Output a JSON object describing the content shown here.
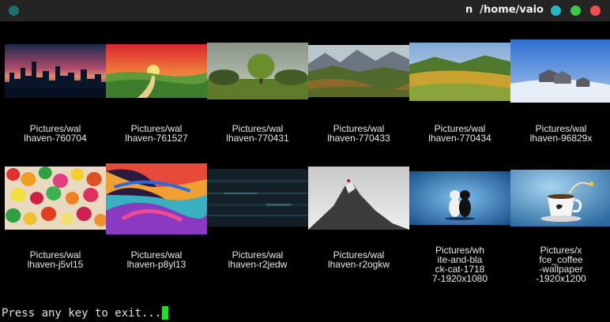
{
  "window": {
    "title": "n  /home/vaio",
    "colors": {
      "menu_dot": "#1e6e6e",
      "minimize": "#21b8c8",
      "maximize": "#3cc84e",
      "close": "#f05050"
    }
  },
  "gallery": {
    "items": [
      {
        "caption": "Pictures/wal\nlhaven-760704",
        "icon": "city-skyline-thumbnail"
      },
      {
        "caption": "Pictures/wal\nlhaven-761527",
        "icon": "sunset-road-thumbnail"
      },
      {
        "caption": "Pictures/wal\nlhaven-770431",
        "icon": "tree-field-thumbnail"
      },
      {
        "caption": "Pictures/wal\nlhaven-770433",
        "icon": "mountain-valley-thumbnail"
      },
      {
        "caption": "Pictures/wal\nlhaven-770434",
        "icon": "meadow-thumbnail"
      },
      {
        "caption": "Pictures/wal\nlhaven-96829x",
        "icon": "snow-houses-thumbnail"
      },
      {
        "caption": "Pictures/wal\nlhaven-j5vl15",
        "icon": "candy-thumbnail"
      },
      {
        "caption": "Pictures/wal\nlhaven-p8yl13",
        "icon": "swirl-art-thumbnail"
      },
      {
        "caption": "Pictures/wal\nlhaven-r2jedw",
        "icon": "glitch-dark-thumbnail"
      },
      {
        "caption": "Pictures/wal\nlhaven-r2ogkw",
        "icon": "mountain-peak-thumbnail"
      },
      {
        "caption": "Pictures/wh\nite-and-bla\nck-cat-1718\n7-1920x1080",
        "icon": "cats-thumbnail"
      },
      {
        "caption": "Pictures/x\nfce_coffee\n-wallpaper\n-1920x1200",
        "icon": "coffee-cup-thumbnail"
      }
    ]
  },
  "terminal": {
    "prompt": "Press any key to exit..."
  },
  "cursor_color": "#19e619"
}
